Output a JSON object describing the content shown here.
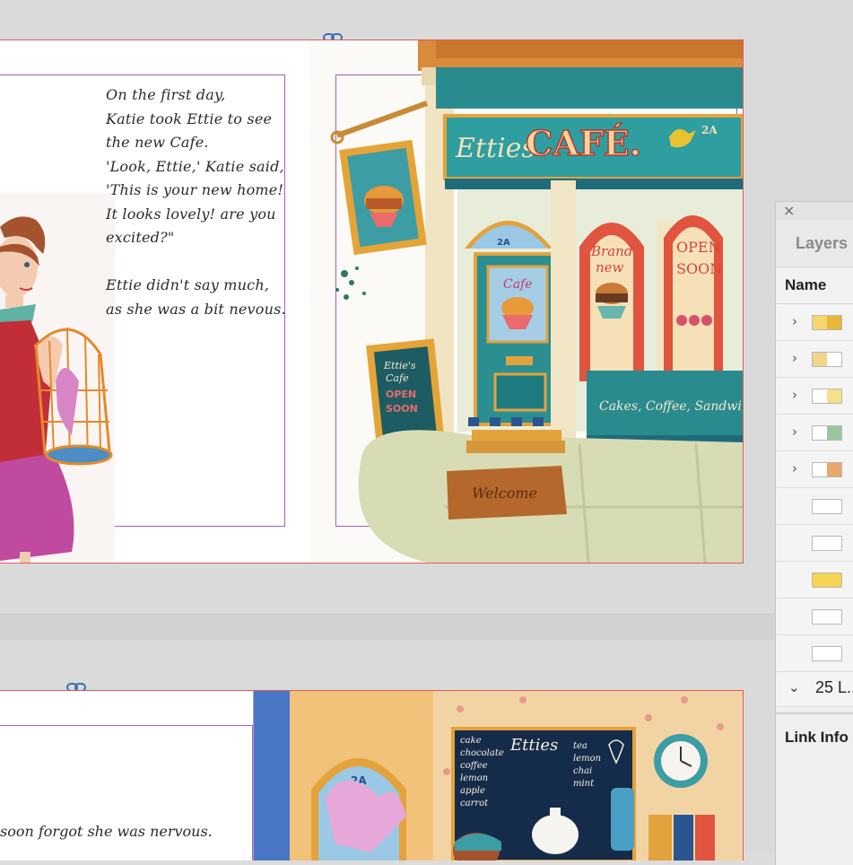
{
  "spread1": {
    "story_text": "On the first day,\nKatie took Ettie to see\nthe new Cafe.\n'Look, Ettie,' Katie said,\n'This is your new home!\nIt looks lovely! are you\nexcited?\"\n\nEttie didn't say much,\nas she was a bit nevous.",
    "cafe_sign": "Etties",
    "cafe_word": "CAFÉ.",
    "cafe_number": "2A",
    "brand_new_sign": "Brand new",
    "open_soon_sign": "OPEN SOON",
    "door_sign": "Cafe",
    "chalkboard_sign": "Ettie's Cafe OPEN SOON",
    "awning_text": "Cakes, Coffee, Sandwi",
    "welcome_mat": "Welcome"
  },
  "spread2": {
    "story_text": "soon forgot she was nervous.",
    "menu_title": "Etties",
    "menu_left": [
      "cake",
      "chocolate",
      "coffee",
      "lemon",
      "apple",
      "carrot"
    ],
    "menu_right": [
      "tea",
      "lemon",
      "chai",
      "mint"
    ],
    "window_number": "2A"
  },
  "layers_panel": {
    "tab_label": "Layers",
    "column_header": "Name",
    "group_label": "25 L...",
    "link_info_label": "Link Info",
    "rows": [
      {
        "expandable": true,
        "thumb_colors": [
          "#f5d76e",
          "#e8b63a"
        ]
      },
      {
        "expandable": true,
        "thumb_colors": [
          "#f2d58a",
          "#ffffff"
        ]
      },
      {
        "expandable": true,
        "thumb_colors": [
          "#ffffff",
          "#f4e18a"
        ]
      },
      {
        "expandable": true,
        "thumb_colors": [
          "#ffffff",
          "#9cc4a0"
        ]
      },
      {
        "expandable": true,
        "thumb_colors": [
          "#ffffff",
          "#e8a86a"
        ]
      },
      {
        "expandable": false,
        "thumb_colors": [
          "#ffffff",
          "#ffffff"
        ]
      },
      {
        "expandable": false,
        "thumb_colors": [
          "#ffffff",
          "#ffffff"
        ]
      },
      {
        "expandable": false,
        "thumb_colors": [
          "#f6d553",
          "#f6d553"
        ]
      },
      {
        "expandable": false,
        "thumb_colors": [
          "#ffffff",
          "#ffffff"
        ]
      },
      {
        "expandable": false,
        "thumb_colors": [
          "#ffffff",
          "#ffffff"
        ]
      }
    ]
  },
  "colors": {
    "bleed_guide": "#e15a5a",
    "margin_guide": "#a060b8",
    "cafe_teal": "#2f8f90",
    "cafe_red": "#e1543f",
    "cafe_yellow": "#f3b94a"
  }
}
